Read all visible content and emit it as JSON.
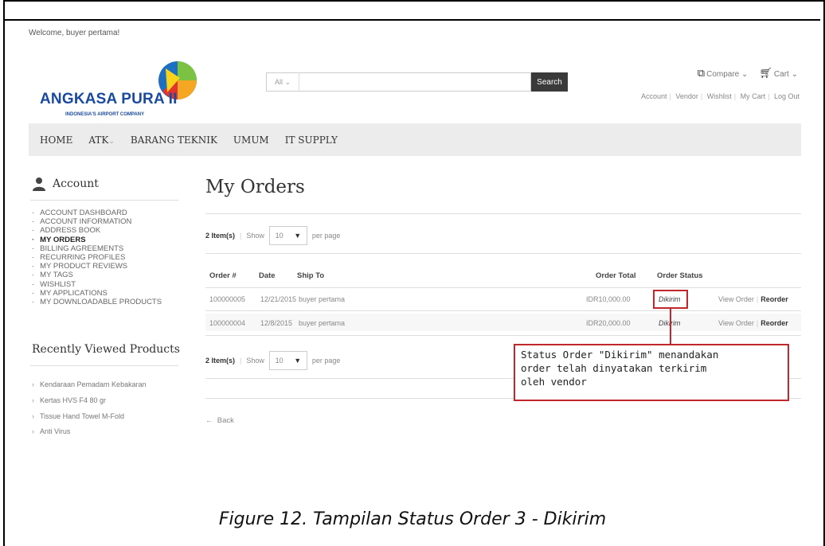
{
  "header": {
    "welcome": "Welcome, buyer pertama!",
    "logo_brand": "ANGKASA PURA II",
    "logo_tagline": "INDONESIA'S AIRPORT COMPANY",
    "search_category": "All",
    "search_button": "Search",
    "compare_label": "Compare",
    "cart_label": "Cart",
    "account_links": [
      "Account",
      "Vendor",
      "Wishlist",
      "My Cart",
      "Log Out"
    ]
  },
  "nav": {
    "items": [
      "HOME",
      "ATK",
      "BARANG TEKNIK",
      "UMUM",
      "IT SUPPLY"
    ]
  },
  "sidebar": {
    "title": "Account",
    "items": [
      "ACCOUNT DASHBOARD",
      "ACCOUNT INFORMATION",
      "ADDRESS BOOK",
      "MY ORDERS",
      "BILLING AGREEMENTS",
      "RECURRING PROFILES",
      "MY PRODUCT REVIEWS",
      "MY TAGS",
      "WISHLIST",
      "MY APPLICATIONS",
      "MY DOWNLOADABLE PRODUCTS"
    ],
    "active_item": "MY ORDERS",
    "recent_title": "Recently Viewed Products",
    "recent_items": [
      "Kendaraan Pemadam Kebakaran",
      "Kertas HVS F4 80 gr",
      "Tissue Hand Towel M-Fold",
      "Anti Virus"
    ]
  },
  "main": {
    "title": "My Orders",
    "pager": {
      "items_count": "2 Item(s)",
      "show_label": "Show",
      "per_page_value": "10",
      "per_page_label": "per page"
    },
    "columns": {
      "order": "Order #",
      "date": "Date",
      "ship_to": "Ship To",
      "total": "Order Total",
      "status": "Order Status"
    },
    "rows": [
      {
        "order": "100000005",
        "date": "12/21/2015",
        "ship_to": "buyer pertama",
        "total": "IDR10,000.00",
        "status": "Dikirim",
        "view": "View Order",
        "reorder": "Reorder"
      },
      {
        "order": "100000004",
        "date": "12/8/2015",
        "ship_to": "buyer pertama",
        "total": "IDR20,000.00",
        "status": "Dikirim",
        "view": "View Order",
        "reorder": "Reorder"
      }
    ],
    "back_label": "Back"
  },
  "annotation": {
    "callout_text": "Status Order \"Dikirim\" menandakan\norder telah dinyatakan terkirim\noleh vendor",
    "highlight_color": "#c0272d"
  },
  "caption": "Figure 12. Tampilan Status Order 3 - Dikirim"
}
